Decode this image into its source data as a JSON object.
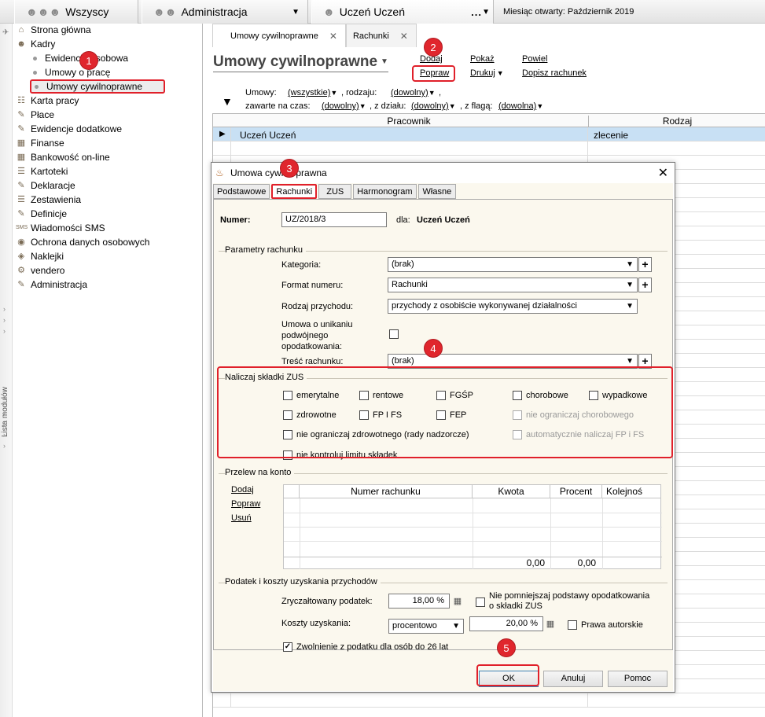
{
  "topbar": {
    "tab1": "Wszyscy",
    "tab2": "Administracja",
    "tab3": "Uczeń Uczeń",
    "tab3_more": "...",
    "month_label": "Miesiąc otwarty:",
    "month_value": "Październik 2019"
  },
  "sidebar": {
    "vertical_label": "Lista modułów",
    "items": [
      {
        "label": "Strona główna",
        "icon": "home-icon"
      },
      {
        "label": "Kadry",
        "icon": "people-icon"
      },
      {
        "label": "Ewidencja osobowa",
        "sub": true
      },
      {
        "label": "Umowy o pracę",
        "sub": true
      },
      {
        "label": "Umowy cywilnoprawne",
        "sub": true,
        "selected": true
      },
      {
        "label": "Karta pracy",
        "icon": "card-icon"
      },
      {
        "label": "Płace",
        "icon": "pay-icon"
      },
      {
        "label": "Ewidencje dodatkowe",
        "icon": "records-icon"
      },
      {
        "label": "Finanse",
        "icon": "finance-icon"
      },
      {
        "label": "Bankowość on-line",
        "icon": "bank-icon"
      },
      {
        "label": "Kartoteki",
        "icon": "files-icon"
      },
      {
        "label": "Deklaracje",
        "icon": "declaration-icon"
      },
      {
        "label": "Zestawienia",
        "icon": "report-icon"
      },
      {
        "label": "Definicje",
        "icon": "definition-icon"
      },
      {
        "label": "Wiadomości SMS",
        "icon": "sms-icon"
      },
      {
        "label": "Ochrona danych osobowych",
        "icon": "shield-icon"
      },
      {
        "label": "Naklejki",
        "icon": "sticker-icon"
      },
      {
        "label": "vendero",
        "icon": "gear-icon"
      },
      {
        "label": "Administracja",
        "icon": "admin-icon"
      }
    ]
  },
  "doc_tabs": [
    "Umowy cywilnoprawne",
    "Rachunki"
  ],
  "page_title": "Umowy cywilnoprawne",
  "actions": {
    "dodaj": "Dodaj",
    "popraw": "Popraw",
    "pokaz": "Pokaż",
    "drukuj": "Drukuj",
    "powiel": "Powiel",
    "dopisz": "Dopisz rachunek"
  },
  "filters": {
    "umowy_label": "Umowy:",
    "umowy_value": "(wszystkie)",
    "rodzaju_label": ", rodzaju:",
    "rodzaju_value": "(dowolny)",
    "comma": ",",
    "zawarte_label": "zawarte na czas:",
    "zawarte_value": "(dowolny)",
    "dzialu_label": ", z działu:",
    "dzialu_value": "(dowolny)",
    "flaga_label": ", z flagą:",
    "flaga_value": "(dowolna)"
  },
  "grid": {
    "col_pracownik": "Pracownik",
    "col_rodzaj": "Rodzaj",
    "rows": [
      {
        "pracownik": "Uczeń Uczeń",
        "rodzaj": "zlecenie"
      }
    ]
  },
  "dialog": {
    "title": "Umowa cywilnoprawna",
    "tabs": [
      "Podstawowe",
      "Rachunki",
      "ZUS",
      "Harmonogram",
      "Własne"
    ],
    "numer_label": "Numer:",
    "numer_value": "UZ/2018/3",
    "dla_label": "dla:",
    "dla_value": "Uczeń Uczeń",
    "params": {
      "legend": "Parametry rachunku",
      "kategoria_label": "Kategoria:",
      "kategoria_value": "(brak)",
      "format_label": "Format numeru:",
      "format_value": "Rachunki",
      "rodzaj_label": "Rodzaj przychodu:",
      "rodzaj_value": "przychody z osobiście wykonywanej działalności",
      "umowa_label_1": "Umowa o unikaniu",
      "umowa_label_2": "podwójnego",
      "umowa_label_3": "opodatkowania:",
      "tresc_label": "Treść rachunku:",
      "tresc_value": "(brak)"
    },
    "zus": {
      "legend": "Naliczaj składki ZUS",
      "emerytalne": "emerytalne",
      "rentowe": "rentowe",
      "fgsp": "FGŚP",
      "chorobowe": "chorobowe",
      "wypadkowe": "wypadkowe",
      "zdrowotne": "zdrowotne",
      "fpifs": "FP I FS",
      "fep": "FEP",
      "nie_ogr_chor": "nie ograniczaj chorobowego",
      "nie_ogr_zdrow": "nie ograniczaj zdrowotnego (rady nadzorcze)",
      "auto_fp": "automatycznie naliczaj FP i FS",
      "nie_kontroluj": "nie kontroluj limitu składek"
    },
    "przelew": {
      "legend": "Przelew na konto",
      "dodaj": "Dodaj",
      "popraw": "Popraw",
      "usun": "Usuń",
      "col_numer": "Numer rachunku",
      "col_kwota": "Kwota",
      "col_procent": "Procent",
      "col_kolejnosc": "Kolejnoś",
      "total_kwota": "0,00",
      "total_procent": "0,00"
    },
    "podatek": {
      "legend": "Podatek i koszty uzyskania przychodów",
      "zrycz_label": "Zryczałtowany podatek:",
      "zrycz_value": "18,00 %",
      "nie_pomn_1": "Nie pomniejszaj podstawy opodatkowania",
      "nie_pomn_2": "o składki ZUS",
      "koszty_label": "Koszty uzyskania:",
      "koszty_type": "procentowo",
      "koszty_value": "20,00 %",
      "prawa": "Prawa autorskie",
      "zwolnienie": "Zwolnienie z podatku dla osób do 26 lat",
      "zwolnienie_checked": true
    },
    "buttons": {
      "ok": "OK",
      "anuluj": "Anuluj",
      "pomoc": "Pomoc"
    }
  },
  "badges": [
    "1",
    "2",
    "3",
    "4",
    "5"
  ]
}
